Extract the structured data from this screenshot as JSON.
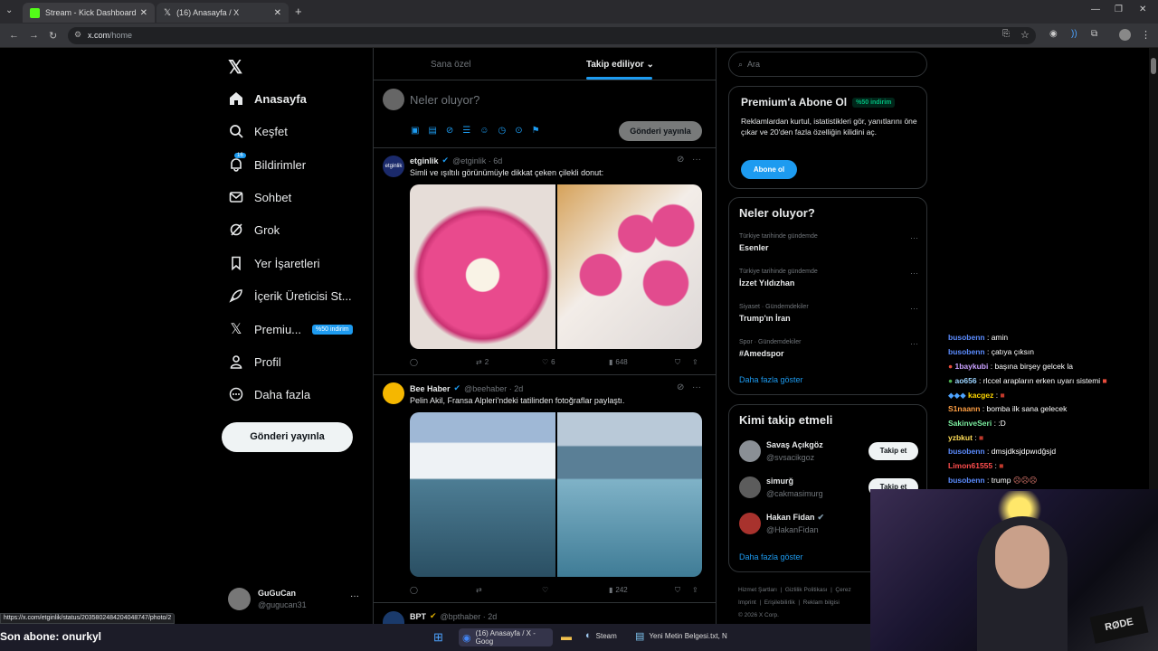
{
  "browser": {
    "tabs": [
      {
        "title": "Stream - Kick Dashboard"
      },
      {
        "title": "(16) Anasayfa / X"
      }
    ],
    "url_host": "x.com",
    "url_path": "/home",
    "status_url": "https://x.com/etginlik/status/2035802484204048747/photo/2"
  },
  "nav": {
    "items": [
      {
        "label": "Anasayfa",
        "icon": "home-icon"
      },
      {
        "label": "Keşfet",
        "icon": "search-icon"
      },
      {
        "label": "Bildirimler",
        "icon": "bell-icon",
        "badge": "16"
      },
      {
        "label": "Sohbet",
        "icon": "mail-icon"
      },
      {
        "label": "Grok",
        "icon": "grok-icon"
      },
      {
        "label": "Yer İşaretleri",
        "icon": "bookmark-icon"
      },
      {
        "label": "İçerik Üreticisi St...",
        "icon": "rocket-icon"
      },
      {
        "label": "Premiu...",
        "icon": "x-logo-icon",
        "badge": "%50 indirim"
      },
      {
        "label": "Profil",
        "icon": "person-icon"
      },
      {
        "label": "Daha fazla",
        "icon": "more-circle-icon"
      }
    ],
    "post_button": "Gönderi yayınla",
    "account": {
      "name": "GuGuCan",
      "handle": "@gugucan31"
    }
  },
  "feed": {
    "tabs": [
      {
        "label": "Sana özel"
      },
      {
        "label": "Takip ediliyor"
      }
    ],
    "compose_placeholder": "Neler oluyor?",
    "compose_button": "Gönderi yayınla",
    "tweets": [
      {
        "name": "etginlik",
        "handle": "@etginlik · 6d",
        "text": "Simli ve ışıltılı görünümüyle dikkat çeken çilekli donut:",
        "retweets": "2",
        "likes": "6",
        "views": "648"
      },
      {
        "name": "Bee Haber",
        "handle": "@beehaber · 2d",
        "text": "Pelin Akil, Fransa Alpleri'ndeki tatilinden fotoğraflar paylaştı.",
        "retweets": "",
        "likes": "",
        "views": "242"
      },
      {
        "name": "BPT",
        "handle": "@bpthaber · 2d"
      }
    ]
  },
  "right": {
    "search_placeholder": "Ara",
    "premium": {
      "title": "Premium'a Abone Ol",
      "badge": "%50 indirim",
      "text": "Reklamlardan kurtul, istatistikleri gör, yanıtlarını öne çıkar ve 20'den fazla özelliğin kilidini aç.",
      "button": "Abone ol"
    },
    "trends_title": "Neler oluyor?",
    "trends": [
      {
        "context": "Türkiye tarihinde gündemde",
        "name": "Esenler"
      },
      {
        "context": "Türkiye tarihinde gündemde",
        "name": "İzzet Yıldızhan"
      },
      {
        "context": "Siyaset · Gündemdekiler",
        "name": "Trump'ın İran"
      },
      {
        "context": "Spor · Gündemdekiler",
        "name": "#Amedspor"
      }
    ],
    "show_more": "Daha fazla göster",
    "who_title": "Kimi takip etmeli",
    "who": [
      {
        "name": "Savaş Açıkgöz",
        "handle": "@svsacikgoz",
        "button": "Takip et"
      },
      {
        "name": "simurğ",
        "handle": "@cakmasimurg",
        "button": "Takip et"
      },
      {
        "name": "Hakan Fidan",
        "handle": "@HakanFidan"
      }
    ],
    "footer": [
      "Hizmet Şartları",
      "Gizlilik Politikası",
      "Çerez",
      "Imprint",
      "Erişilebilirlik",
      "Reklam bilgisi",
      "© 2026 X Corp."
    ]
  },
  "chat": [
    {
      "user": "busobenn",
      "msg": ": amin",
      "color": "#5b8cff"
    },
    {
      "user": "busobenn",
      "msg": ": çatıya çıksın",
      "color": "#5b8cff"
    },
    {
      "user": "1baykubi",
      "msg": ": başına birşey gelcek la",
      "color": "#c9a0ff"
    },
    {
      "user": "ao656",
      "msg": ": rlccel arapların erken uyarı sistemi",
      "color": "#9bd3ff"
    },
    {
      "user": "kacgez",
      "msg": ":",
      "color": "#ffd700"
    },
    {
      "user": "S1naann",
      "msg": ": bomba ilk sana gelecek",
      "color": "#ff9f43"
    },
    {
      "user": "SakinveSeri",
      "msg": ": :D",
      "color": "#7bed9f"
    },
    {
      "user": "yzbkut",
      "msg": ":",
      "color": "#ffdd57"
    },
    {
      "user": "busobenn",
      "msg": ": dmsjdksjdpwıdğsjd",
      "color": "#5b8cff"
    },
    {
      "user": "Limon61555",
      "msg": ":",
      "color": "#ff4d4d"
    },
    {
      "user": "busobenn",
      "msg": ": trump",
      "color": "#5b8cff"
    }
  ],
  "overlay": {
    "last_sub": "Son abone: onurkyl"
  },
  "taskbar": [
    {
      "label": "(16) Anasayfa / X - Goog"
    },
    {
      "label": "Steam"
    },
    {
      "label": "Yeni Metin Belgesi.txt, N"
    }
  ]
}
